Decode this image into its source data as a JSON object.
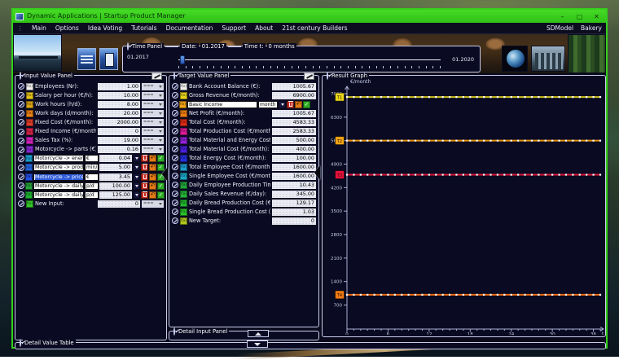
{
  "window": {
    "title": "Dynamic Applications | Startup Product Manager"
  },
  "icons": {
    "minimize": "–",
    "maximize": "▢",
    "close": "✕",
    "undo": "↶",
    "check": "✓",
    "menu_grip": "⋮"
  },
  "menu": {
    "items": [
      "Main",
      "Options",
      "Idea Voting",
      "Tutorials",
      "Documentation",
      "Support",
      "About",
      "21st century Builders"
    ],
    "right_items": [
      "SDModel",
      "Bakery"
    ]
  },
  "time_panel": {
    "title": "Time Panel",
    "date_label": "Date:",
    "date_value": "01.2017",
    "time_label": "Time t:",
    "time_value": "0 months",
    "start_label": "01.2017",
    "end_label": "01.2020"
  },
  "input_panel": {
    "title": "Input Value Panel",
    "chip_label": "f(x)",
    "dropdown_label": "===",
    "rows": [
      {
        "label": "Employees (Nr):",
        "value": "1.00",
        "chip": "#f2f2f2",
        "mode": "dropdown"
      },
      {
        "label": "Salary per hour (€/h):",
        "value": "10.00",
        "chip": "#e6c419",
        "mode": "dropdown"
      },
      {
        "label": "Work hours (h/d):",
        "value": "8.00",
        "chip": "#dfa614",
        "mode": "dropdown"
      },
      {
        "label": "Work days (d/month):",
        "value": "20.00",
        "chip": "#ee8213",
        "mode": "dropdown"
      },
      {
        "label": "Fixed Cost (€/month):",
        "value": "2000.00",
        "chip": "#e23c28",
        "mode": "dropdown"
      },
      {
        "label": "Fixed Income (€/month):",
        "value": "0",
        "chip": "#da2248",
        "mode": "dropdown"
      },
      {
        "label": "Sales Tax (%):",
        "value": "19.00",
        "chip": "#d923c3",
        "mode": "dropdown"
      },
      {
        "label": "Motorcycle -> parts (€):",
        "value": "0.16",
        "chip": "#8b27d8",
        "mode": "dropdown"
      },
      {
        "label": "Motorcycle -> energy cost",
        "unit": "€",
        "value": "0.04",
        "chip": "#1b9fd0",
        "mode": "edit"
      },
      {
        "label": "Motorcycle -> production ti",
        "unit": "min/p",
        "value": "5.00",
        "chip": "#2565e0",
        "mode": "edit"
      },
      {
        "label": "Motorcycle -> price",
        "unit": "€",
        "value": "3.45",
        "chip": "#2450e6",
        "mode": "edit",
        "selected": true
      },
      {
        "label": "Motorcycle -> daily sales",
        "unit": "p/d",
        "value": "100.00",
        "chip": "#27a43a",
        "mode": "edit"
      },
      {
        "label": "Motorcycle -> daily product",
        "unit": "p/d",
        "value": "125.00",
        "chip": "#1fb332",
        "mode": "edit"
      },
      {
        "label": "New Input:",
        "value": "0",
        "chip": "#35c92a",
        "mode": "dropdown"
      }
    ]
  },
  "target_panel": {
    "title": "Target Value Panel",
    "chip_label": "f(x)",
    "rows": [
      {
        "label": "Bank Account Balance (€):",
        "value": "1005.67",
        "chip": "#f2f2f2",
        "mode": "value"
      },
      {
        "label": "Gross Revenue (€/month):",
        "value": "6900.00",
        "chip": "#e8d51c",
        "mode": "value"
      },
      {
        "label": "Basic Income",
        "unit": "month",
        "chip": "#f0a315",
        "mode": "edit"
      },
      {
        "label": "Net Profit (€/month):",
        "value": "1005.67",
        "chip": "#f08013",
        "mode": "value"
      },
      {
        "label": "Total Cost (€/month):",
        "value": "4583.33",
        "chip": "#e02b17",
        "mode": "value"
      },
      {
        "label": "Total Production Cost (€/month):",
        "value": "2583.33",
        "chip": "#e01b9b",
        "mode": "value"
      },
      {
        "label": "Total Material and Energy Cost (€/month):",
        "value": "500.00",
        "chip": "#9122da",
        "mode": "value"
      },
      {
        "label": "Total Material Cost (€/month):",
        "value": "400.00",
        "chip": "#4b1fe0",
        "mode": "value"
      },
      {
        "label": "Total Energy Cost (€/month):",
        "value": "100.00",
        "chip": "#2430e2",
        "mode": "value"
      },
      {
        "label": "Total Employee Cost (€/month):",
        "value": "1600.00",
        "chip": "#1c9fd2",
        "mode": "value"
      },
      {
        "label": "Single Employee Cost (€/month):",
        "value": "1600.00",
        "chip": "#1ba8c8",
        "mode": "value"
      },
      {
        "label": "Daily Employee Production Time (h/day):",
        "value": "10.43",
        "chip": "#22a63c",
        "mode": "value"
      },
      {
        "label": "Daily Sales Revenue (€/day):",
        "value": "345.00",
        "chip": "#25b33a",
        "mode": "value"
      },
      {
        "label": "Daily Bread Production Cost (€/day):",
        "value": "129.17",
        "chip": "#21b42f",
        "mode": "value"
      },
      {
        "label": "Single Bread Production Cost (€):",
        "value": "1.03",
        "chip": "#2bc12c",
        "mode": "value"
      },
      {
        "label": "New Target:",
        "value": "0",
        "chip": "#b2c81e",
        "mode": "value"
      }
    ]
  },
  "detail_input_panel": {
    "title": "Detail Input Panel"
  },
  "detail_value_table": {
    "title": "Detail Value Table"
  },
  "chart_data": {
    "type": "line",
    "title": "Result Graph",
    "ylabel": "€/month",
    "xlabel": "t",
    "x_major_ticks": [
      0,
      6,
      12,
      18,
      24,
      30,
      36
    ],
    "x_minor_step": 1,
    "x_months": 37,
    "y_ticks": [
      700,
      1400,
      2100,
      2800,
      3500,
      4200,
      4900,
      5600,
      6300,
      7000
    ],
    "ylim": [
      0,
      7300
    ],
    "grid": false,
    "marker": {
      "shape": "square",
      "color": "#ffffff"
    },
    "series": [
      {
        "name": "T1",
        "value": 6900,
        "color": "#cfc11d",
        "label_bg": "#e8d51c"
      },
      {
        "name": "T2",
        "value": 5600,
        "color": "#e8930f",
        "label_bg": "#f0a315"
      },
      {
        "name": "T3",
        "value": 4583.33,
        "color": "#dc1438",
        "label_bg": "#e6103c"
      },
      {
        "name": "T4",
        "value": 1005.67,
        "color": "#ef6a10",
        "label_bg": "#f07a12"
      }
    ]
  }
}
